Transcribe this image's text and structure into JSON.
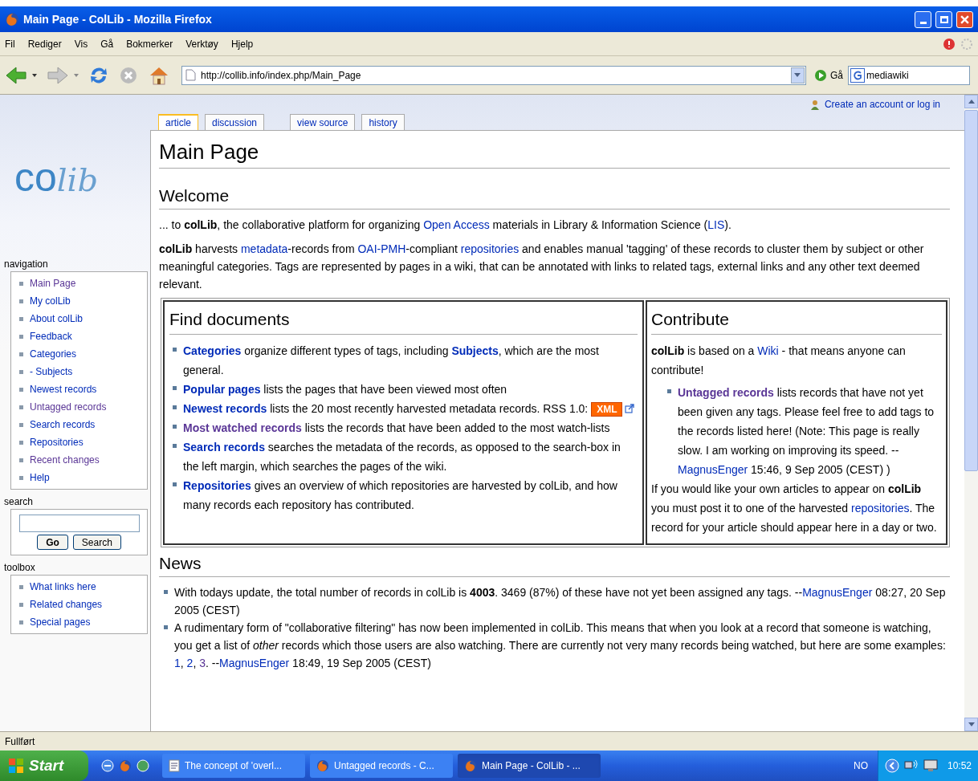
{
  "window": {
    "title": "Main Page - ColLib - Mozilla Firefox"
  },
  "menu": [
    "Fil",
    "Rediger",
    "Vis",
    "Gå",
    "Bokmerker",
    "Verktøy",
    "Hjelp"
  ],
  "toolbar": {
    "address": "http://collib.info/index.php/Main_Page",
    "go": "Gå",
    "search_value": "mediawiki"
  },
  "personal": "Create an account or log in",
  "tabs": [
    {
      "label": "article",
      "selected": true
    },
    {
      "label": "discussion",
      "selected": false
    },
    {
      "label": "view source",
      "selected": false
    },
    {
      "label": "history",
      "selected": false
    }
  ],
  "sidebar": {
    "logo": "colib",
    "navigation": {
      "title": "navigation",
      "items": [
        {
          "label": "Main Page",
          "visited": true
        },
        {
          "label": "My colLib",
          "visited": false
        },
        {
          "label": "About colLib",
          "visited": false
        },
        {
          "label": "Feedback",
          "visited": false
        },
        {
          "label": "Categories",
          "visited": false
        },
        {
          "label": "- Subjects",
          "visited": false
        },
        {
          "label": "Newest records",
          "visited": false
        },
        {
          "label": "Untagged records",
          "visited": true
        },
        {
          "label": "Search records",
          "visited": false
        },
        {
          "label": "Repositories",
          "visited": false
        },
        {
          "label": "Recent changes",
          "visited": true
        },
        {
          "label": "Help",
          "visited": false
        }
      ]
    },
    "search": {
      "title": "search",
      "buttons": [
        "Go",
        "Search"
      ]
    },
    "toolbox": {
      "title": "toolbox",
      "items": [
        {
          "label": "What links here",
          "visited": false
        },
        {
          "label": "Related changes",
          "visited": false
        },
        {
          "label": "Special pages",
          "visited": false
        }
      ]
    }
  },
  "page": {
    "title": "Main Page",
    "welcome": {
      "heading": "Welcome",
      "paragraphs": [
        [
          {
            "kind": "text",
            "t": "... to **colLib**, the collaborative platform for organizing "
          },
          {
            "kind": "link",
            "t": "Open Access",
            "bold": false,
            "visited": false
          },
          {
            "kind": "text",
            "t": " materials in Library & Information Science ("
          },
          {
            "kind": "link",
            "t": "LIS",
            "bold": false,
            "visited": false
          },
          {
            "kind": "text",
            "t": ")."
          }
        ],
        [
          {
            "kind": "text",
            "t": "**colLib** harvests "
          },
          {
            "kind": "link",
            "t": "metadata",
            "bold": false,
            "visited": false
          },
          {
            "kind": "text",
            "t": "-records from "
          },
          {
            "kind": "link",
            "t": "OAI-PMH",
            "bold": false,
            "visited": false
          },
          {
            "kind": "text",
            "t": "-compliant "
          },
          {
            "kind": "link",
            "t": "repositories",
            "bold": false,
            "visited": false
          },
          {
            "kind": "text",
            "t": " and enables manual 'tagging' of these records to cluster them by subject or other meaningful categories. Tags are represented by pages in a wiki, that can be annotated with links to related tags, external links and any other text deemed relevant."
          }
        ]
      ]
    },
    "find_documents": {
      "heading": "Find documents",
      "items": [
        [
          {
            "kind": "link",
            "t": "Categories",
            "bold": true,
            "visited": false
          },
          {
            "kind": "text",
            "t": " organize different types of tags, including "
          },
          {
            "kind": "link",
            "t": "Subjects",
            "bold": true,
            "visited": false
          },
          {
            "kind": "text",
            "t": ", which are the most general."
          }
        ],
        [
          {
            "kind": "link",
            "t": "Popular pages",
            "bold": true,
            "visited": false
          },
          {
            "kind": "text",
            "t": " lists the pages that have been viewed most often"
          }
        ],
        [
          {
            "kind": "link",
            "t": "Newest records",
            "bold": true,
            "visited": false
          },
          {
            "kind": "text",
            "t": " lists the 20 most recently harvested metadata records. RSS 1.0: "
          },
          {
            "kind": "badge",
            "t": "XML"
          }
        ],
        [
          {
            "kind": "link",
            "t": "Most watched records",
            "bold": true,
            "visited": true
          },
          {
            "kind": "text",
            "t": " lists the records that have been added to the most watch-lists"
          }
        ],
        [
          {
            "kind": "link",
            "t": "Search records",
            "bold": true,
            "visited": false
          },
          {
            "kind": "text",
            "t": " searches the metadata of the records, as opposed to the search-box in the left margin, which searches the pages of the wiki."
          }
        ],
        [
          {
            "kind": "link",
            "t": "Repositories",
            "bold": true,
            "visited": false
          },
          {
            "kind": "text",
            "t": " gives an overview of which repositories are harvested by colLib, and how many records each repository has contributed."
          }
        ]
      ]
    },
    "contribute": {
      "heading": "Contribute",
      "intro": [
        {
          "kind": "text",
          "t": "**colLib** is based on a "
        },
        {
          "kind": "link",
          "t": "Wiki",
          "bold": false,
          "visited": false
        },
        {
          "kind": "text",
          "t": " - that means anyone can contribute!"
        }
      ],
      "items": [
        [
          {
            "kind": "link",
            "t": "Untagged records",
            "bold": true,
            "visited": true
          },
          {
            "kind": "text",
            "t": " lists records that have not yet been given any tags. Please feel free to add tags to the records listed here! (Note: This page is really slow. I am working on improving its speed. --"
          },
          {
            "kind": "link",
            "t": "MagnusEnger",
            "bold": false,
            "visited": false
          },
          {
            "kind": "text",
            "t": " 15:46, 9 Sep 2005 (CEST) )"
          }
        ]
      ],
      "outro": [
        {
          "kind": "text",
          "t": "If you would like your own articles to appear on **colLib** you must post it to one of the harvested "
        },
        {
          "kind": "link",
          "t": "repositories",
          "bold": false,
          "visited": false
        },
        {
          "kind": "text",
          "t": ". The record for your article should appear here in a day or two."
        }
      ]
    },
    "news": {
      "heading": "News",
      "items": [
        [
          {
            "kind": "text",
            "t": "With todays update, the total number of records in colLib is **4003**. 3469 (87%) of these have not yet been assigned any tags. --"
          },
          {
            "kind": "link",
            "t": "MagnusEnger",
            "bold": false,
            "visited": false
          },
          {
            "kind": "text",
            "t": " 08:27, 20 Sep 2005 (CEST)"
          }
        ],
        [
          {
            "kind": "text",
            "t": "A rudimentary form of \"collaborative filtering\" has now been implemented in colLib. This means that when you look at a record that someone is watching, you get a list of *other* records which those users are also watching. There are currently not very many records being watched, but here are some examples: "
          },
          {
            "kind": "link",
            "t": "1",
            "bold": false,
            "visited": false
          },
          {
            "kind": "text",
            "t": ", "
          },
          {
            "kind": "link",
            "t": "2",
            "bold": false,
            "visited": false
          },
          {
            "kind": "text",
            "t": ", "
          },
          {
            "kind": "link",
            "t": "3",
            "bold": false,
            "visited": true
          },
          {
            "kind": "text",
            "t": ". --"
          },
          {
            "kind": "link",
            "t": "MagnusEnger",
            "bold": false,
            "visited": false
          },
          {
            "kind": "text",
            "t": " 18:49, 19 Sep 2005 (CEST)"
          }
        ]
      ]
    }
  },
  "status_bar": "Fullført",
  "taskbar": {
    "start": "Start",
    "tasks": [
      {
        "label": "The concept of 'overl...",
        "kind": "document",
        "selected": false
      },
      {
        "label": "Untagged records - C...",
        "kind": "browser",
        "selected": false
      },
      {
        "label": "Main Page - ColLib - ...",
        "kind": "browser",
        "selected": true
      }
    ],
    "language": "NO",
    "clock": "10:52"
  }
}
